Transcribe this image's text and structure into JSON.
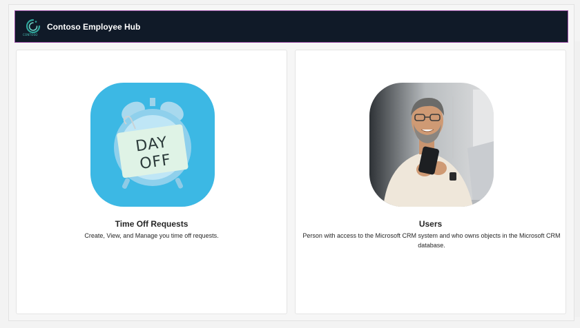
{
  "header": {
    "title": "Contoso Employee Hub",
    "logo_text": "CONTOSO",
    "logo_icon": "contoso-logo-icon",
    "background_color": "#101a28",
    "border_color": "#9b4fa8"
  },
  "cards": [
    {
      "title": "Time Off Requests",
      "description": "Create, View, and Manage you time off requests.",
      "image_icon": "alarm-clock-day-off-image",
      "image_text": "DAY OFF"
    },
    {
      "title": "Users",
      "description": "Person with access to the Microsoft CRM system and who owns objects in the Microsoft CRM database.",
      "image_icon": "person-with-phone-image"
    }
  ]
}
